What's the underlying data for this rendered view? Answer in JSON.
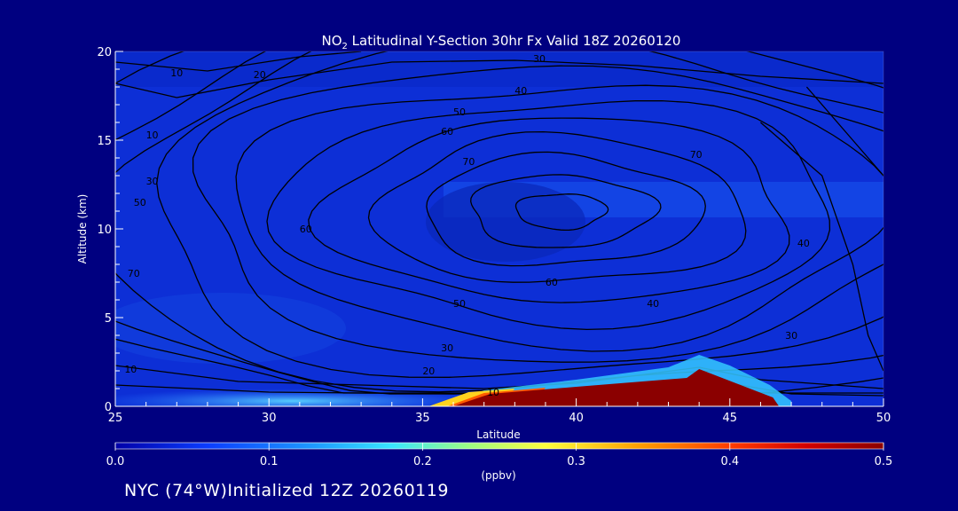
{
  "chart_data": {
    "type": "heatmap",
    "title": "NO",
    "title_sub": "2",
    "title_rest": " Latitudinal Y-Section 30hr  Fx Valid 18Z 20260120",
    "xlabel": "Latitude",
    "ylabel": "Altitude (km)",
    "xlim": [
      25,
      50
    ],
    "ylim": [
      0,
      20
    ],
    "xticks": [
      "25",
      "30",
      "35",
      "40",
      "45",
      "50"
    ],
    "yticks": [
      "0",
      "5",
      "10",
      "15",
      "20"
    ],
    "colorbar": {
      "range": [
        0.0,
        0.5
      ],
      "ticks": [
        "0.0",
        "0.1",
        "0.2",
        "0.3",
        "0.4",
        "0.5"
      ],
      "unit": "(ppbv)"
    },
    "no2_field": [
      {
        "lat": 25,
        "alt": 0,
        "value": 0.05
      },
      {
        "lat": 30,
        "alt": 0,
        "value": 0.06
      },
      {
        "lat": 35,
        "alt": 0,
        "value": 0.14
      },
      {
        "lat": 37,
        "alt": 0.5,
        "value": 0.38
      },
      {
        "lat": 40,
        "alt": 0.8,
        "value": 0.48
      },
      {
        "lat": 43.5,
        "alt": 1.2,
        "value": 0.5
      },
      {
        "lat": 44,
        "alt": 2.5,
        "value": 0.15
      },
      {
        "lat": 46.5,
        "alt": 0.3,
        "value": 0.35
      },
      {
        "lat": 40,
        "alt": 10,
        "value": 0.04
      },
      {
        "lat": 45,
        "alt": 11,
        "value": 0.1
      }
    ],
    "contour_labels": [
      {
        "text": "10",
        "lat": 27,
        "alt": 18.8
      },
      {
        "text": "20",
        "lat": 29.7,
        "alt": 18.7
      },
      {
        "text": "30",
        "lat": 38.8,
        "alt": 19.6
      },
      {
        "text": "40",
        "lat": 38.2,
        "alt": 17.8
      },
      {
        "text": "50",
        "lat": 36.2,
        "alt": 16.6
      },
      {
        "text": "60",
        "lat": 35.8,
        "alt": 15.5
      },
      {
        "text": "70",
        "lat": 36.5,
        "alt": 13.8
      },
      {
        "text": "10",
        "lat": 26.2,
        "alt": 15.3
      },
      {
        "text": "30",
        "lat": 26.2,
        "alt": 12.7
      },
      {
        "text": "50",
        "lat": 25.8,
        "alt": 11.5
      },
      {
        "text": "60",
        "lat": 31.2,
        "alt": 10
      },
      {
        "text": "70",
        "lat": 25.6,
        "alt": 7.5
      },
      {
        "text": "60",
        "lat": 39.2,
        "alt": 7
      },
      {
        "text": "50",
        "lat": 36.2,
        "alt": 5.8
      },
      {
        "text": "40",
        "lat": 42.5,
        "alt": 5.8
      },
      {
        "text": "30",
        "lat": 35.8,
        "alt": 3.3
      },
      {
        "text": "20",
        "lat": 35.2,
        "alt": 2
      },
      {
        "text": "10",
        "lat": 25.5,
        "alt": 2.1
      },
      {
        "text": "10",
        "lat": 37.3,
        "alt": 0.8
      },
      {
        "text": "70",
        "lat": 43.9,
        "alt": 14.2
      },
      {
        "text": "40",
        "lat": 47.4,
        "alt": 9.2
      },
      {
        "text": "30",
        "lat": 47,
        "alt": 4
      }
    ]
  },
  "footer": {
    "text": "NYC (74°W)Initialized 12Z 20260119"
  },
  "colors": {
    "background": "#000080",
    "field_base": "#0d2fd6",
    "contour": "#000000",
    "axes": "#ffffff"
  }
}
